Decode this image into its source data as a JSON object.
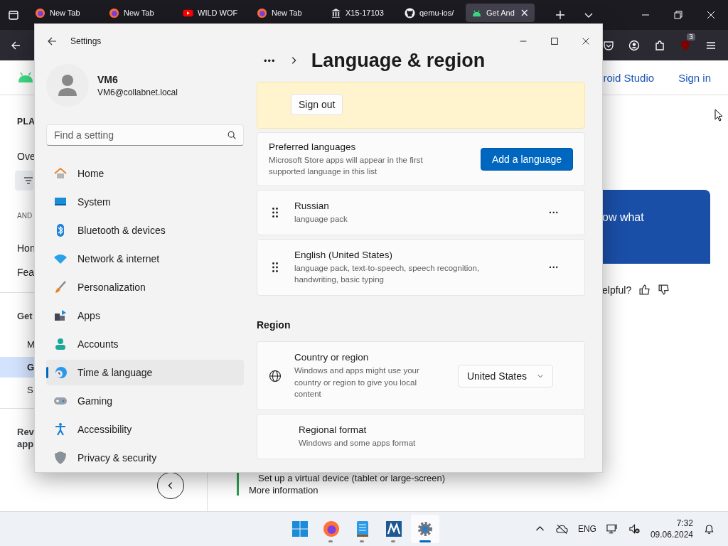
{
  "browser": {
    "tabs": [
      {
        "title": "New Tab",
        "kind": "firefox",
        "selected": false
      },
      {
        "title": "New Tab",
        "kind": "firefox",
        "selected": false
      },
      {
        "title": "WILD WOF",
        "kind": "youtube",
        "selected": false
      },
      {
        "title": "New Tab",
        "kind": "firefox",
        "selected": false
      },
      {
        "title": "X15-17103",
        "kind": "museum",
        "selected": false
      },
      {
        "title": "qemu-ios/",
        "kind": "github",
        "selected": false
      },
      {
        "title": "Get And",
        "kind": "android",
        "selected": true
      }
    ],
    "close_tab": "×",
    "extension_badge": "3"
  },
  "web_page": {
    "header_links": [
      "roid Studio",
      "Sign in"
    ],
    "left_nav": [
      {
        "text": "PLA",
        "kind": "title"
      },
      {
        "text": "Ove",
        "kind": "item",
        "selected": false
      },
      {
        "kind": "chip"
      },
      {
        "text": "AND",
        "kind": "section"
      },
      {
        "text": "Hon",
        "kind": "item",
        "selected": false
      },
      {
        "text": "Fea",
        "kind": "item",
        "selected": false
      },
      {
        "kind": "divider"
      },
      {
        "text": "Get",
        "kind": "heading"
      },
      {
        "text": "M",
        "kind": "subitem",
        "selected": false
      },
      {
        "text": "G",
        "kind": "subitem",
        "selected": true
      },
      {
        "text": "S",
        "kind": "subitem",
        "selected": false
      },
      {
        "kind": "divider"
      },
      {
        "text": "Rev\napp",
        "kind": "heading"
      }
    ],
    "banner_text": "ow what",
    "feedback_question": "elpful?",
    "bullet_text": "Set up a virtual device (tablet or large-screen)",
    "more_link": "More information"
  },
  "settings": {
    "title": "Settings",
    "user_name": "VM6",
    "user_email": "VM6@collabnet.local",
    "search": {
      "placeholder": "Find a setting"
    },
    "nav": [
      {
        "label": "Home",
        "kind": "home",
        "selected": false
      },
      {
        "label": "System",
        "kind": "system",
        "selected": false
      },
      {
        "label": "Bluetooth & devices",
        "kind": "bluetooth",
        "selected": false
      },
      {
        "label": "Network & internet",
        "kind": "network",
        "selected": false
      },
      {
        "label": "Personalization",
        "kind": "brush",
        "selected": false
      },
      {
        "label": "Apps",
        "kind": "apps",
        "selected": false
      },
      {
        "label": "Accounts",
        "kind": "accounts",
        "selected": false
      },
      {
        "label": "Time & language",
        "kind": "time",
        "selected": true
      },
      {
        "label": "Gaming",
        "kind": "gaming",
        "selected": false
      },
      {
        "label": "Accessibility",
        "kind": "accessibility",
        "selected": false
      },
      {
        "label": "Privacy & security",
        "kind": "privacy",
        "selected": false
      }
    ],
    "breadcrumb_more": "•••",
    "heading": "Language & region",
    "sign_out_button": "Sign out",
    "preferred": {
      "title": "Preferred languages",
      "description": "Microsoft Store apps will appear in the first supported language in this list",
      "button": "Add a language"
    },
    "languages": [
      {
        "name": "Russian",
        "details": "language pack"
      },
      {
        "name": "English (United States)",
        "details": "language pack, text-to-speech, speech recognition, handwriting, basic typing"
      }
    ],
    "more_button": "···",
    "region_heading": "Region",
    "country": {
      "title": "Country or region",
      "description": "Windows and apps might use your country or region to give you local content",
      "value": "United States"
    },
    "regional_format": {
      "title": "Regional format",
      "description": "Windows and some apps format"
    }
  },
  "taskbar": {
    "apps": [
      {
        "kind": "start",
        "selected": false
      },
      {
        "kind": "firefox",
        "selected": false
      },
      {
        "kind": "notepad",
        "selected": false
      },
      {
        "kind": "m-app",
        "selected": false
      },
      {
        "kind": "settings",
        "selected": true
      }
    ],
    "language": "ENG",
    "time": "7:32",
    "date": "09.06.2024"
  }
}
